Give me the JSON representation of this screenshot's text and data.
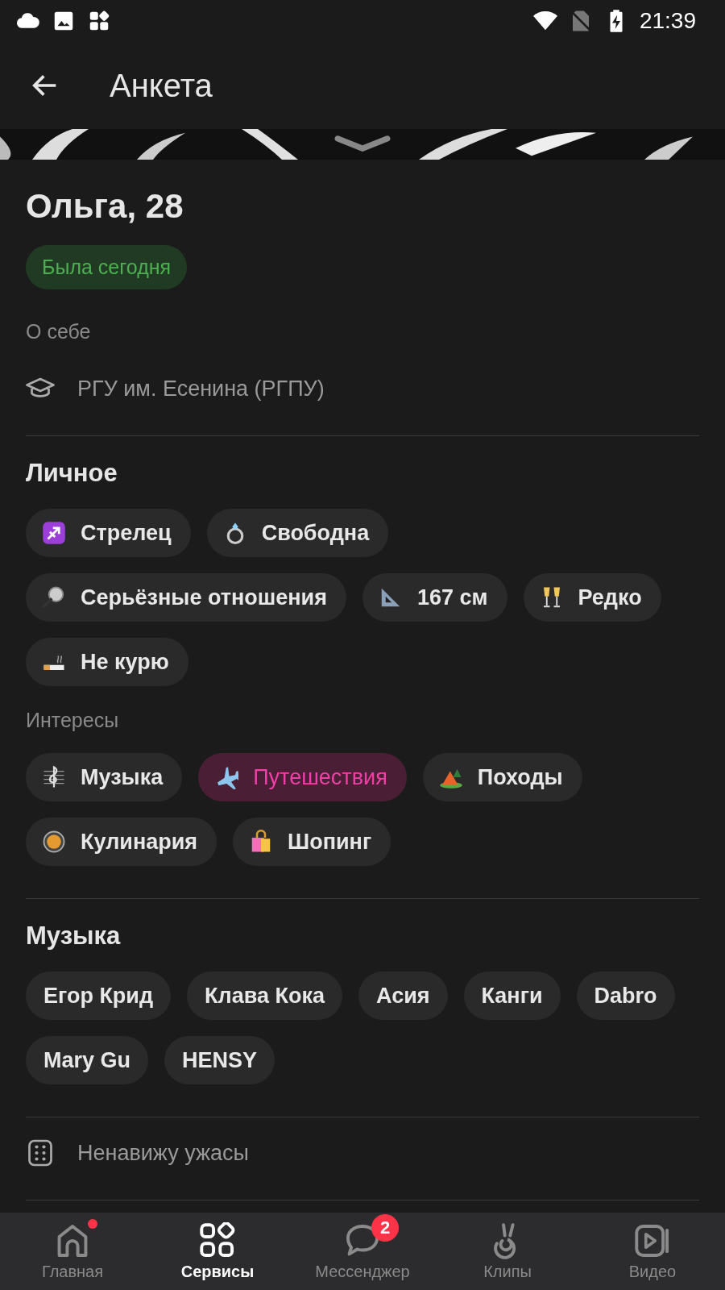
{
  "status_bar": {
    "time": "21:39"
  },
  "app_bar": {
    "title": "Анкета"
  },
  "profile": {
    "name": "Ольга, 28",
    "online_badge": "Была сегодня",
    "about_label": "О себе",
    "education": "РГУ им. Есенина (РГПУ)"
  },
  "personal": {
    "title": "Личное",
    "chips": [
      {
        "kind": "zodiac",
        "label": "Стрелец"
      },
      {
        "kind": "ring",
        "label": "Свободна"
      },
      {
        "kind": "magnifier",
        "label": "Серьёзные отношения"
      },
      {
        "kind": "ruler",
        "label": "167 см"
      },
      {
        "kind": "glasses",
        "label": "Редко"
      },
      {
        "kind": "cigarette",
        "label": "Не курю"
      }
    ]
  },
  "interests": {
    "title": "Интересы",
    "chips": [
      {
        "kind": "music",
        "label": "Музыка",
        "selected": false
      },
      {
        "kind": "plane",
        "label": "Путешествия",
        "selected": true
      },
      {
        "kind": "tent",
        "label": "Походы",
        "selected": false
      },
      {
        "kind": "pan",
        "label": "Кулинария",
        "selected": false
      },
      {
        "kind": "bag",
        "label": "Шопинг",
        "selected": false
      }
    ]
  },
  "music": {
    "title": "Музыка",
    "chips": [
      "Егор Крид",
      "Клава Кока",
      "Асия",
      "Канги",
      "Dabro",
      "Mary Gu",
      "HENSY"
    ]
  },
  "note": {
    "text": "Ненавижу ужасы"
  },
  "bottom_nav": [
    {
      "kind": "home",
      "label": "Главная",
      "selected": false,
      "dot": true
    },
    {
      "kind": "services",
      "label": "Сервисы",
      "selected": true
    },
    {
      "kind": "chat",
      "label": "Мессенджер",
      "selected": false,
      "badge": "2"
    },
    {
      "kind": "clips",
      "label": "Клипы",
      "selected": false
    },
    {
      "kind": "video",
      "label": "Видео",
      "selected": false
    }
  ]
}
